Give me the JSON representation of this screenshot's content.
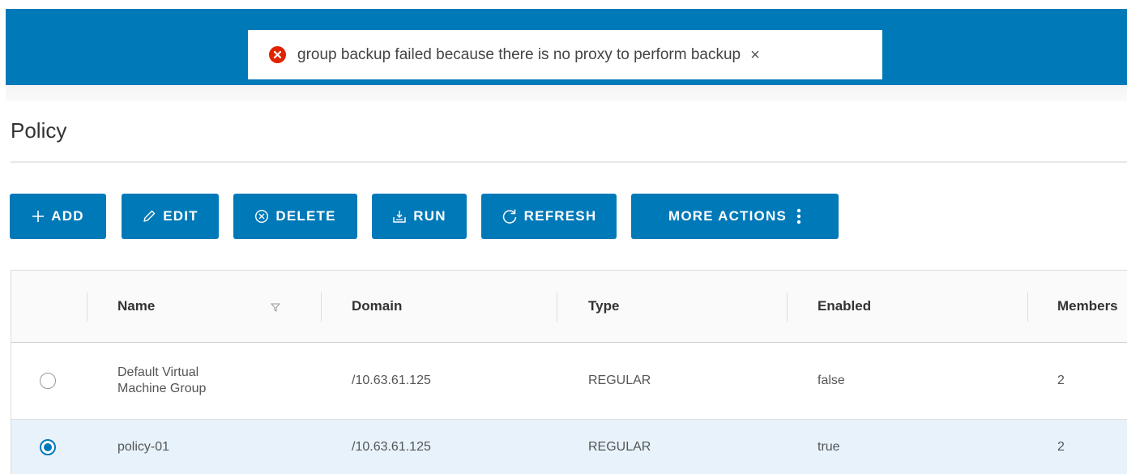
{
  "notification": {
    "message": "group backup failed because there is no proxy to perform backup",
    "close_icon": "×",
    "error_color": "#e12200"
  },
  "page": {
    "title": "Policy"
  },
  "toolbar": {
    "accent_color": "#0079b8",
    "add": {
      "icon": "plus-icon",
      "label": "ADD"
    },
    "edit": {
      "icon": "pencil-icon",
      "label": "EDIT"
    },
    "delete": {
      "icon": "circle-x-icon",
      "label": "DELETE"
    },
    "run": {
      "icon": "tray-run-icon",
      "label": "RUN"
    },
    "refresh": {
      "icon": "refresh-icon",
      "label": "REFRESH"
    },
    "more": {
      "icon": "vertical-ellipsis-icon",
      "label": "MORE ACTIONS"
    }
  },
  "table": {
    "columns": [
      "Name",
      "Domain",
      "Type",
      "Enabled",
      "Members"
    ],
    "rows": [
      {
        "selected": false,
        "name": "Default Virtual\nMachine Group",
        "domain": "/10.63.61.125",
        "type": "REGULAR",
        "enabled": "false",
        "members": "2"
      },
      {
        "selected": true,
        "name": "policy-01",
        "domain": "/10.63.61.125",
        "type": "REGULAR",
        "enabled": "true",
        "members": "2"
      }
    ],
    "selected_row_color": "#e7f2fa"
  }
}
